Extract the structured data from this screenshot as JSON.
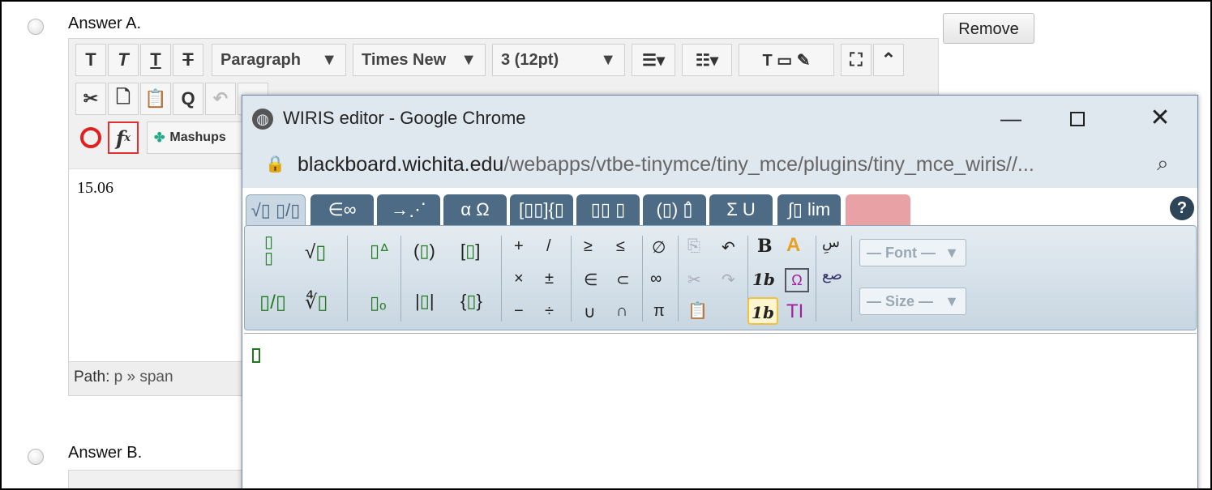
{
  "answers": [
    {
      "label": "Answer A."
    },
    {
      "label": "Answer B."
    }
  ],
  "remove_label": "Remove",
  "toolbar": {
    "paragraph": "Paragraph",
    "font": "Times New",
    "size": "3 (12pt)",
    "mashups": "Mashups"
  },
  "editor": {
    "content": "15.06",
    "path_label": "Path:",
    "path_value": "p » span"
  },
  "popup": {
    "title": "WIRIS editor - Google Chrome",
    "url_host": "blackboard.wichita.edu",
    "url_path": "/webapps/vtbe-tinymce/tiny_mce/plugins/tiny_mce_wiris//...",
    "tabs": [
      "√▯ ▯/▯",
      "∈∞",
      "→⋰",
      "α Ω",
      "[▯▯]{▯",
      "▯▯ ▯",
      "(▯) ▯̂",
      "Σ U",
      "∫▯ lim",
      ""
    ],
    "font_select": "— Font —",
    "size_select": "— Size —"
  },
  "colors": {
    "wiris_tab": "#4d6b85",
    "accent_red": "#e03030"
  }
}
